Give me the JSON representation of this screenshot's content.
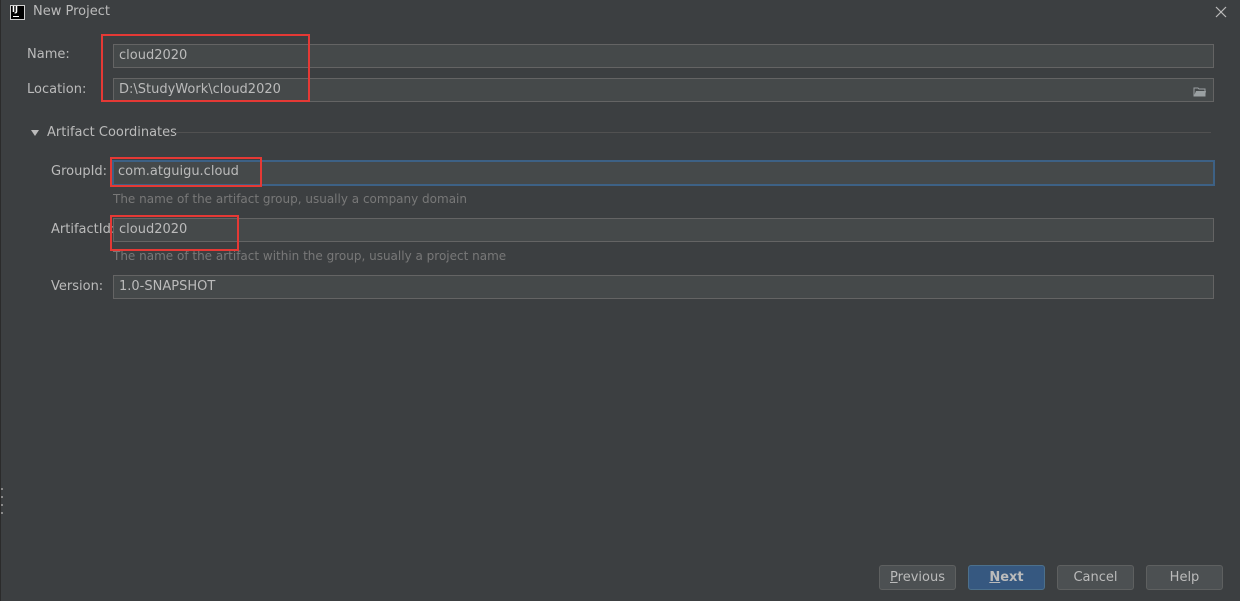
{
  "window": {
    "title": "New Project",
    "app_icon_text": "IJ"
  },
  "form": {
    "name_label": "Name:",
    "name_value": "cloud2020",
    "location_label": "Location:",
    "location_value": "D:\\StudyWork\\cloud2020"
  },
  "artifact": {
    "section_label": "Artifact Coordinates",
    "expanded": true,
    "group_label": "GroupId:",
    "group_value": "com.atguigu.cloud",
    "group_hint": "The name of the artifact group, usually a company domain",
    "artifact_label": "ArtifactId:",
    "artifact_value": "cloud2020",
    "artifact_hint": "The name of the artifact within the group, usually a project name",
    "version_label": "Version:",
    "version_value": "1.0-SNAPSHOT"
  },
  "buttons": {
    "previous_mnemonic": "P",
    "previous_rest": "revious",
    "next_mnemonic": "N",
    "next_rest": "ext",
    "cancel": "Cancel",
    "help": "Help"
  },
  "colors": {
    "background": "#3c3f41",
    "field_bg": "#45494a",
    "focus_border": "#3d6185",
    "primary_button": "#365880",
    "annotation_red": "#e53935"
  }
}
